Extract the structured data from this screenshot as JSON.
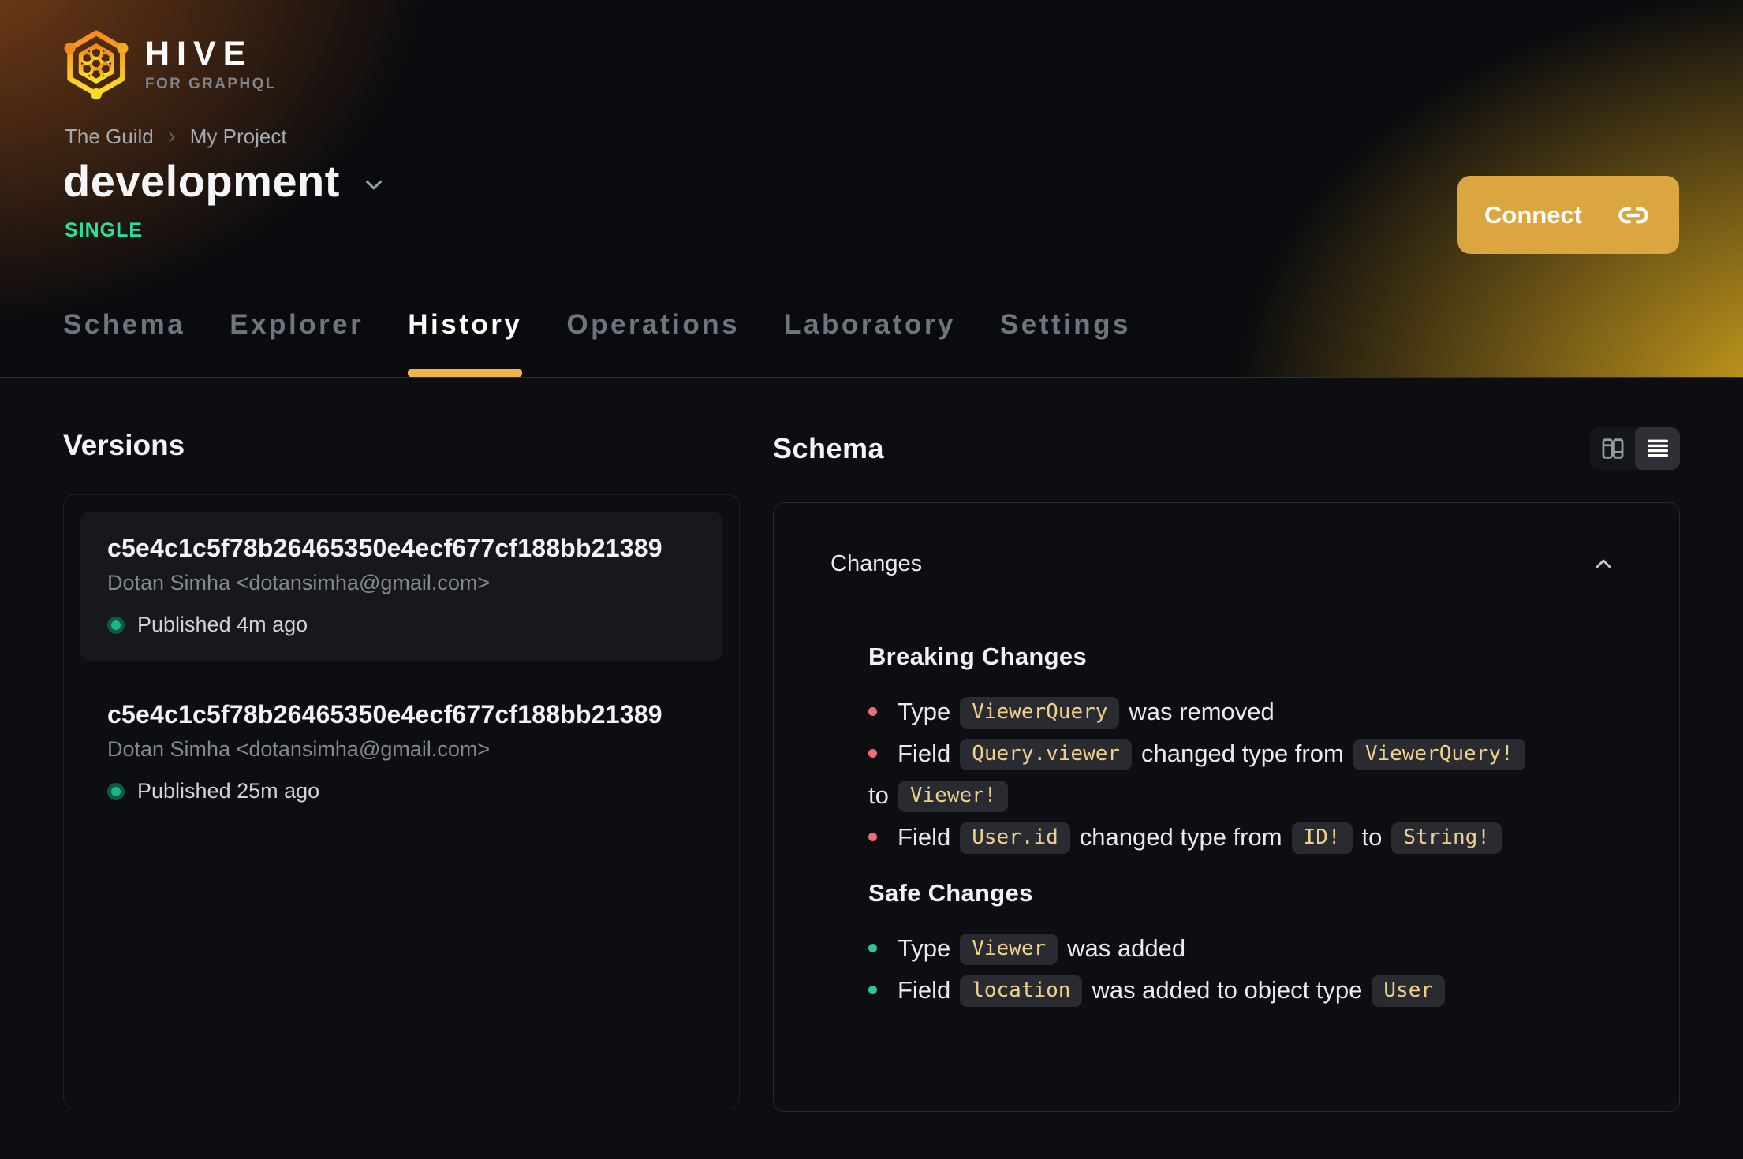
{
  "brand": {
    "name": "HIVE",
    "tagline": "FOR GRAPHQL"
  },
  "breadcrumb": {
    "org": "The Guild",
    "project": "My Project"
  },
  "target": {
    "name": "development",
    "badge": "SINGLE"
  },
  "connect": {
    "label": "Connect"
  },
  "tabs": [
    {
      "label": "Schema",
      "active": false
    },
    {
      "label": "Explorer",
      "active": false
    },
    {
      "label": "History",
      "active": true
    },
    {
      "label": "Operations",
      "active": false
    },
    {
      "label": "Laboratory",
      "active": false
    },
    {
      "label": "Settings",
      "active": false
    }
  ],
  "versions": {
    "heading": "Versions",
    "items": [
      {
        "hash": "c5e4c1c5f78b26465350e4ecf677cf188bb21389",
        "author": "Dotan Simha <dotansimha@gmail.com>",
        "status": "Published 4m ago",
        "selected": true
      },
      {
        "hash": "c5e4c1c5f78b26465350e4ecf677cf188bb21389",
        "author": "Dotan Simha <dotansimha@gmail.com>",
        "status": "Published 25m ago",
        "selected": false
      }
    ]
  },
  "schema": {
    "heading": "Schema",
    "view_toggle": {
      "options": [
        "columns-view",
        "list-view"
      ],
      "active": "list-view"
    },
    "changes": {
      "title": "Changes",
      "groups": [
        {
          "title": "Breaking Changes",
          "bullet_color": "#ef6d79",
          "items": [
            {
              "segments": [
                {
                  "t": "text",
                  "v": "Type"
                },
                {
                  "t": "code",
                  "v": "ViewerQuery"
                },
                {
                  "t": "text",
                  "v": "was removed"
                }
              ]
            },
            {
              "segments": [
                {
                  "t": "text",
                  "v": "Field"
                },
                {
                  "t": "code",
                  "v": "Query.viewer"
                },
                {
                  "t": "text",
                  "v": "changed type from"
                },
                {
                  "t": "code",
                  "v": "ViewerQuery!"
                },
                {
                  "t": "break"
                },
                {
                  "t": "text",
                  "v": "to"
                },
                {
                  "t": "code",
                  "v": "Viewer!"
                }
              ]
            },
            {
              "segments": [
                {
                  "t": "text",
                  "v": "Field"
                },
                {
                  "t": "code",
                  "v": "User.id"
                },
                {
                  "t": "text",
                  "v": "changed type from"
                },
                {
                  "t": "code",
                  "v": "ID!"
                },
                {
                  "t": "text",
                  "v": "to"
                },
                {
                  "t": "code",
                  "v": "String!"
                }
              ]
            }
          ]
        },
        {
          "title": "Safe Changes",
          "bullet_color": "#2fc695",
          "items": [
            {
              "segments": [
                {
                  "t": "text",
                  "v": "Type"
                },
                {
                  "t": "code",
                  "v": "Viewer"
                },
                {
                  "t": "text",
                  "v": "was added"
                }
              ]
            },
            {
              "segments": [
                {
                  "t": "text",
                  "v": "Field"
                },
                {
                  "t": "code",
                  "v": "location"
                },
                {
                  "t": "text",
                  "v": "was added to object type"
                },
                {
                  "t": "code",
                  "v": "User"
                }
              ]
            }
          ]
        }
      ]
    }
  },
  "colors": {
    "accent": "#dba63f",
    "tab_underline": "#eeb449",
    "badge_green": "#27e2a4",
    "published_dot": "#1db586",
    "breaking_bullet": "#ef6d79",
    "safe_bullet": "#2fc695",
    "chip_text": "#eed08d",
    "chip_bg": "#2a2b30"
  }
}
